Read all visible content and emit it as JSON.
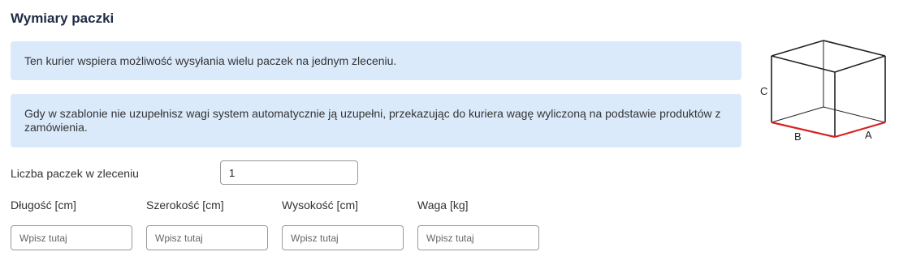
{
  "section": {
    "title": "Wymiary paczki"
  },
  "info": {
    "multi_package": "Ten kurier wspiera możliwość wysyłania wielu paczek na jednym zleceniu.",
    "weight_note": "Gdy w szablonie nie uzupełnisz wagi system automatycznie ją uzupełni, przekazując do kuriera wagę wyliczoną na podstawie produktów z zamówienia."
  },
  "package_count": {
    "label": "Liczba paczek w zleceniu",
    "value": "1"
  },
  "dimensions": {
    "length": {
      "label": "Długość [cm]",
      "placeholder": "Wpisz tutaj"
    },
    "width": {
      "label": "Szerokość [cm]",
      "placeholder": "Wpisz tutaj"
    },
    "height": {
      "label": "Wysokość [cm]",
      "placeholder": "Wpisz tutaj"
    },
    "weight": {
      "label": "Waga [kg]",
      "placeholder": "Wpisz tutaj"
    }
  },
  "diagram": {
    "label_a": "A",
    "label_b": "B",
    "label_c": "C",
    "edge_color": "#222222",
    "highlight_color": "#d92020"
  }
}
